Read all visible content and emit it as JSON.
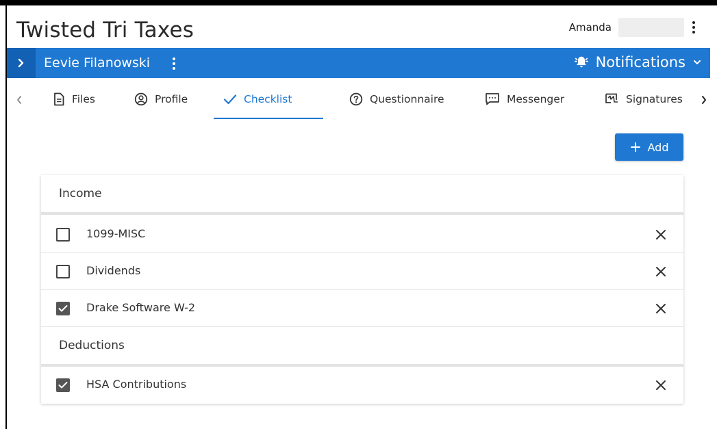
{
  "app": {
    "title": "Twisted Tri Taxes"
  },
  "user": {
    "name": "Amanda"
  },
  "client": {
    "name": "Eevie Filanowski"
  },
  "notifications": {
    "label": "Notifications"
  },
  "tabs": [
    {
      "label": "Files",
      "icon": "file-icon"
    },
    {
      "label": "Profile",
      "icon": "user-circle-icon"
    },
    {
      "label": "Checklist",
      "icon": "check-icon",
      "active": true
    },
    {
      "label": "Questionnaire",
      "icon": "question-circle-icon"
    },
    {
      "label": "Messenger",
      "icon": "message-icon"
    },
    {
      "label": "Signatures",
      "icon": "signature-icon"
    }
  ],
  "toolbar": {
    "add_label": "Add"
  },
  "checklist": {
    "sections": [
      {
        "title": "Income",
        "items": [
          {
            "label": "1099-MISC",
            "checked": false
          },
          {
            "label": "Dividends",
            "checked": false
          },
          {
            "label": "Drake Software W-2",
            "checked": true
          }
        ]
      },
      {
        "title": "Deductions",
        "items": [
          {
            "label": "HSA Contributions",
            "checked": true
          }
        ]
      }
    ]
  },
  "colors": {
    "primary": "#1f78d1",
    "primary_dark": "#1361b5",
    "checkbox_checked": "#555555"
  }
}
